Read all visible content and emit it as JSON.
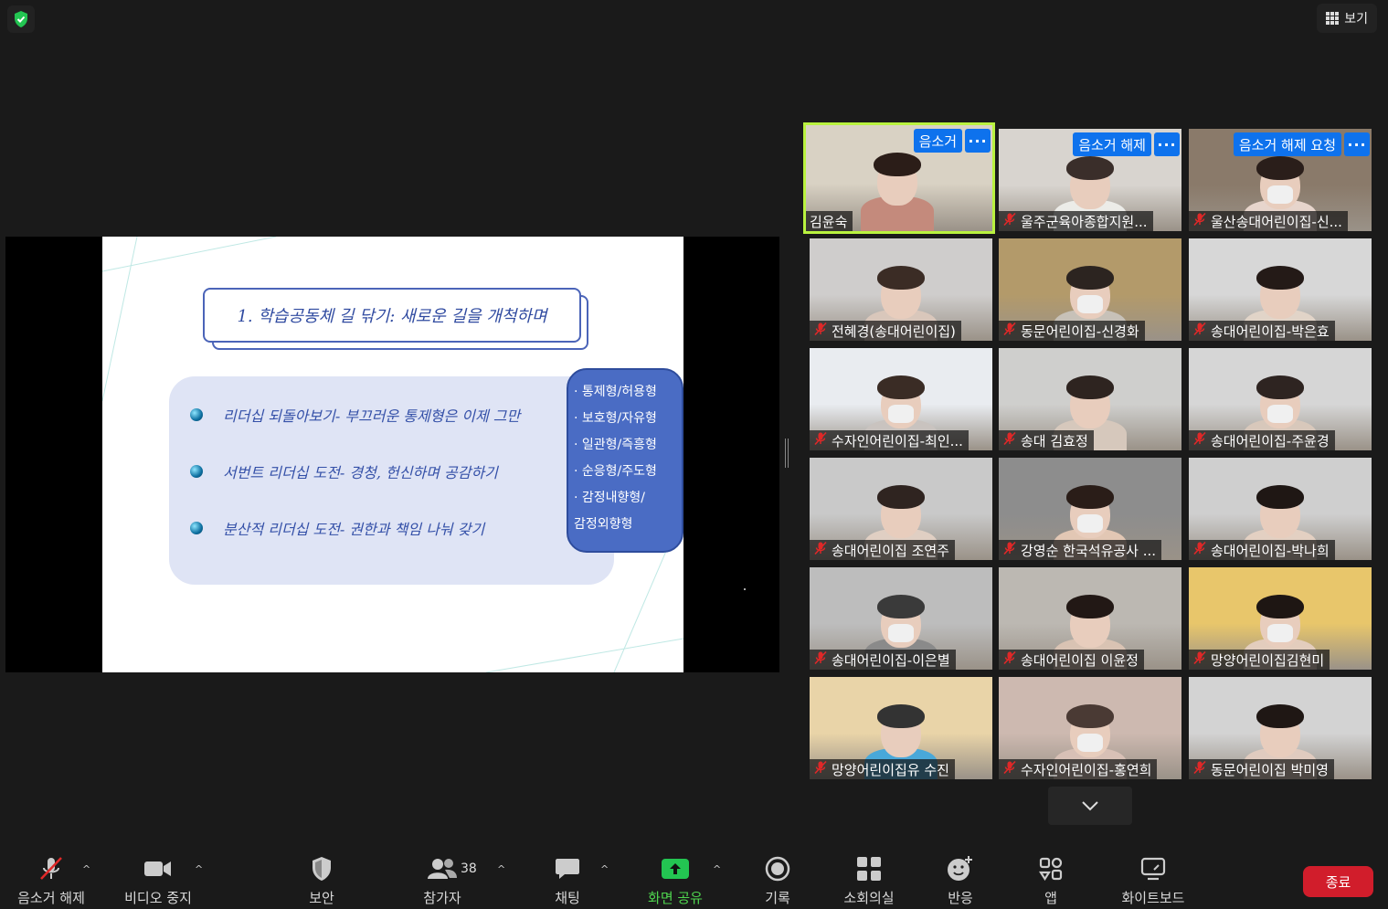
{
  "top": {
    "view_label": "보기"
  },
  "slide": {
    "title": "1. 학습공동체 길 닦기: 새로운 길을 개척하며",
    "bullets": [
      "리더십 되돌아보기- 부끄러운 통제형은 이제 그만",
      "서번트 리더십 도전- 경청, 헌신하며 공감하기",
      "분산적 리더십 도전- 권한과 책임 나눠 갖기"
    ],
    "callout": [
      "· 통제형/허용형",
      "· 보호형/자유형",
      "· 일관형/즉흥형",
      "· 순응형/주도형",
      "· 감정내향형/",
      "감정외향형"
    ]
  },
  "gallery": {
    "tiles": [
      {
        "name": "김윤숙",
        "muted": false,
        "overlay": "음소거"
      },
      {
        "name": "울주군육아종합지원...",
        "muted": true,
        "overlay": "음소거 해제"
      },
      {
        "name": "울산송대어린이집-신...",
        "muted": true,
        "overlay": "음소거 해제 요청"
      },
      {
        "name": "전혜경(송대어린이집)",
        "muted": true
      },
      {
        "name": "동문어린이집-신경화",
        "muted": true
      },
      {
        "name": "송대어린이집-박은효",
        "muted": true
      },
      {
        "name": "수자인어린이집-최인...",
        "muted": true
      },
      {
        "name": "송대 김효정",
        "muted": true
      },
      {
        "name": "송대어린이집-주윤경",
        "muted": true
      },
      {
        "name": "송대어린이집 조연주",
        "muted": true
      },
      {
        "name": "강영순 한국석유공사 ...",
        "muted": true
      },
      {
        "name": "송대어린이집-박나희",
        "muted": true
      },
      {
        "name": "송대어린이집-이은별",
        "muted": true
      },
      {
        "name": "송대어린이집 이윤정",
        "muted": true
      },
      {
        "name": "망양어린이집김현미",
        "muted": true
      },
      {
        "name": "망양어린이집유 수진",
        "muted": true
      },
      {
        "name": "수자인어린이집-홍연희",
        "muted": true
      },
      {
        "name": "동문어린이집 박미영",
        "muted": true
      }
    ],
    "more_label": "···"
  },
  "toolbar": {
    "unmute": "음소거 해제",
    "video": "비디오 중지",
    "security": "보안",
    "participants": "참가자",
    "participants_count": "38",
    "chat": "채팅",
    "share": "화면 공유",
    "record": "기록",
    "breakout": "소회의실",
    "reactions": "반응",
    "apps": "앱",
    "whiteboard": "화이트보드",
    "end": "종료"
  },
  "colors": {
    "accent": "#0e72ed",
    "active_speaker": "#b9f23f",
    "end": "#d11d2b",
    "share_green": "#23c552"
  }
}
